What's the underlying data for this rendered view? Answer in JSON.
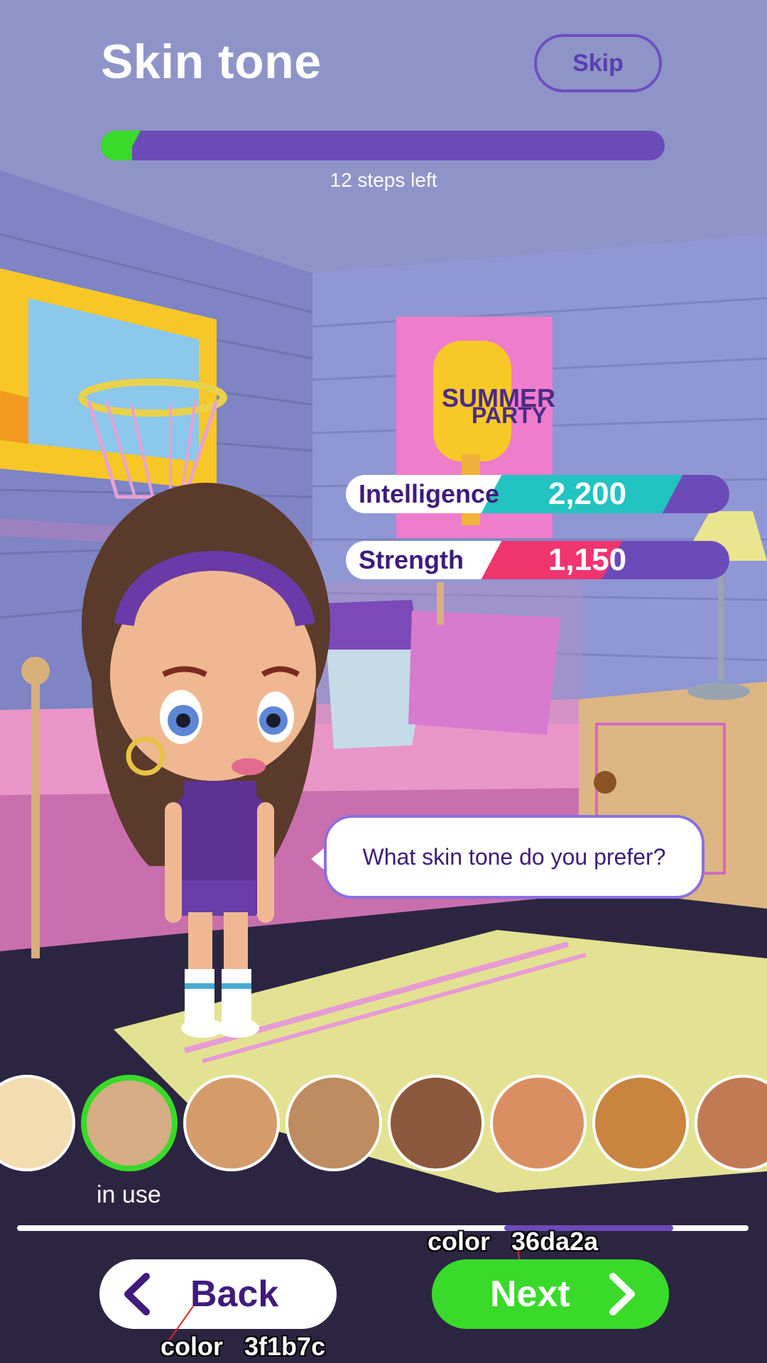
{
  "header": {
    "title": "Skin tone",
    "skip_label": "Skip",
    "progress_fraction": 0.055,
    "steps_left": "12 steps left"
  },
  "poster": {
    "line1": "SUMMER",
    "line2": "PARTY"
  },
  "stats": [
    {
      "label": "Intelligence",
      "value": "2,200",
      "band_color": "#22c3c0"
    },
    {
      "label": "Strength",
      "value": "1,150",
      "band_color": "#f0346e"
    }
  ],
  "bubble": {
    "text": "What skin tone do you prefer?"
  },
  "swatches": {
    "colors": [
      "#f3dcb0",
      "#d6ad85",
      "#d49c6a",
      "#bd8c61",
      "#8b583b",
      "#d98f62",
      "#c9843f",
      "#c27a55"
    ],
    "selected_index": 1,
    "in_use_label": "in use"
  },
  "buttons": {
    "back_label": "Back",
    "next_label": "Next"
  },
  "annotations": {
    "top_label": "color   36da2a",
    "bottom_label": "color   3f1b7c"
  },
  "colors": {
    "accent_green": "#39da2a",
    "accent_purple": "#6b4bb8",
    "text_dark_purple": "#3f1b7c"
  }
}
